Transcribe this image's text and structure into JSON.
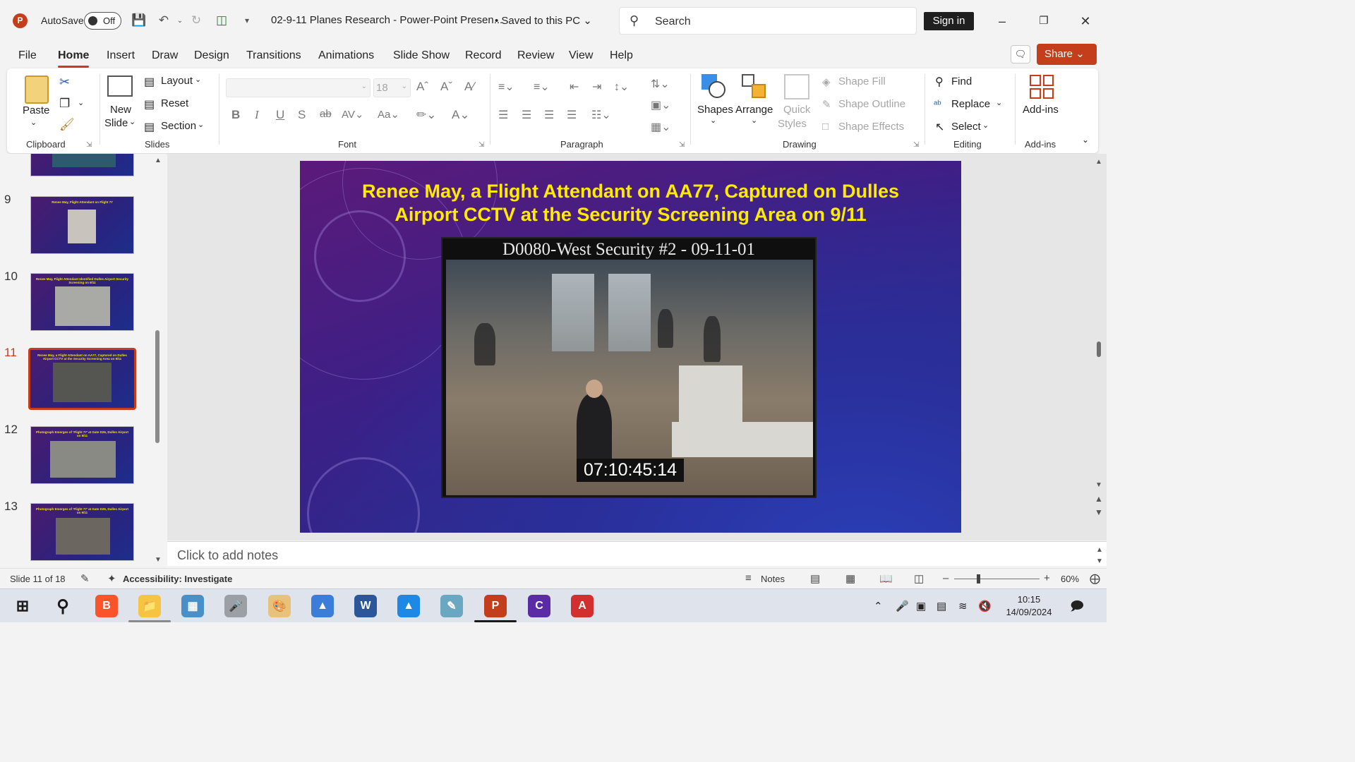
{
  "titlebar": {
    "autosave_label": "AutoSave",
    "autosave_state": "Off",
    "doc_title": "02-9-11 Planes Research - Power-Point Presen...",
    "saved_status": "• Saved to this PC ⌄",
    "search_placeholder": "Search",
    "sign_in": "Sign in"
  },
  "menu": {
    "tabs": [
      "File",
      "Home",
      "Insert",
      "Draw",
      "Design",
      "Transitions",
      "Animations",
      "Slide Show",
      "Record",
      "Review",
      "View",
      "Help"
    ],
    "active": "Home",
    "share_label": "Share"
  },
  "ribbon": {
    "clipboard": {
      "paste": "Paste",
      "group": "Clipboard"
    },
    "slides": {
      "new_slide_1": "New",
      "new_slide_2": "Slide",
      "layout": "Layout",
      "reset": "Reset",
      "section": "Section",
      "group": "Slides"
    },
    "font": {
      "size": "18",
      "group": "Font"
    },
    "paragraph": {
      "group": "Paragraph"
    },
    "drawing": {
      "shapes": "Shapes",
      "arrange": "Arrange",
      "quick_1": "Quick",
      "quick_2": "Styles",
      "shape_fill": "Shape Fill",
      "shape_outline": "Shape Outline",
      "shape_effects": "Shape Effects",
      "group": "Drawing"
    },
    "editing": {
      "find": "Find",
      "replace": "Replace",
      "select": "Select",
      "group": "Editing"
    },
    "addins": {
      "label": "Add-ins",
      "group": "Add-ins"
    }
  },
  "thumbnails": [
    {
      "num": "9",
      "title": "Renee May, Flight Attendant on Flight 77"
    },
    {
      "num": "10",
      "title": "Renee May, Flight Attendant Identified Dulles Airport Security Screening on 9/11"
    },
    {
      "num": "11",
      "title": "Renee May, a Flight Attendant on AA77, Captured on Dulles Airport CCTV at the Security Screening Area on 9/11"
    },
    {
      "num": "12",
      "title": "Photograph Emerges of 'Flight 77' at Gate D26, Dulles Airport on 9/11"
    },
    {
      "num": "13",
      "title": "Photograph Emerges of 'Flight 77' at Gate D26, Dulles Airport on 9/11"
    }
  ],
  "slide": {
    "title": "Renee May, a Flight Attendant on AA77, Captured on Dulles Airport CCTV at the Security Screening Area on 9/11",
    "cctv_label": "D0080-West Security #2 - 09-11-01",
    "timestamp": "07:10:45:14"
  },
  "notes_placeholder": "Click to add notes",
  "status": {
    "slide_count": "Slide 11 of 18",
    "accessibility": "Accessibility: Investigate",
    "notes": "Notes",
    "zoom": "60%"
  },
  "clock": {
    "time": "10:15",
    "date": "14/09/2024"
  },
  "colors": {
    "accent": "#c43e1c",
    "slide_title": "#ffea00"
  }
}
